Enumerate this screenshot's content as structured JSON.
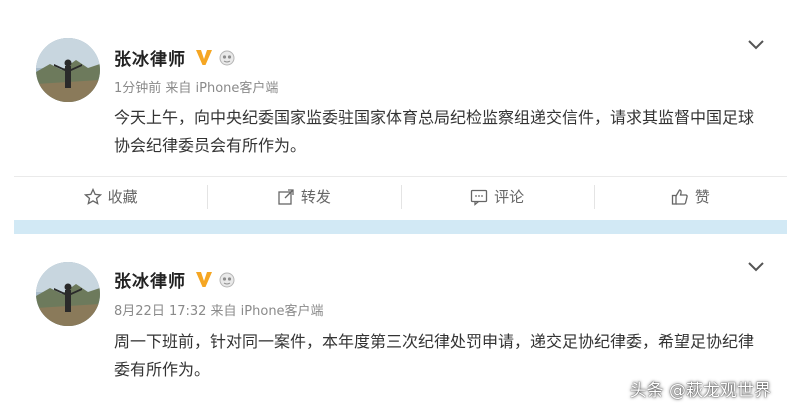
{
  "posts": [
    {
      "author": "张冰律师",
      "verified_icon": "verified-v-icon",
      "medal_icon": "medal-icon",
      "meta": "1分钟前 来自 iPhone客户端",
      "content": "今天上午，向中央纪委国家监委驻国家体育总局纪检监察组递交信件，请求其监督中国足球协会纪律委员会有所作为。",
      "actions": [
        {
          "icon": "star-icon",
          "label": "收藏"
        },
        {
          "icon": "share-icon",
          "label": "转发"
        },
        {
          "icon": "comment-icon",
          "label": "评论"
        },
        {
          "icon": "thumbs-up-icon",
          "label": "赞"
        }
      ]
    },
    {
      "author": "张冰律师",
      "verified_icon": "verified-v-icon",
      "medal_icon": "medal-icon",
      "meta": "8月22日 17:32 来自 iPhone客户端",
      "content": "周一下班前，针对同一案件，本年度第三次纪律处罚申请，递交足协纪律委，希望足协纪律委有所作为。"
    }
  ],
  "watermark": "头条 @萩龙观世界",
  "colors": {
    "divider_band": "#d2e9f5",
    "verified_badge": "#f5a623",
    "text": "#333333",
    "meta": "#8a8a8a"
  }
}
